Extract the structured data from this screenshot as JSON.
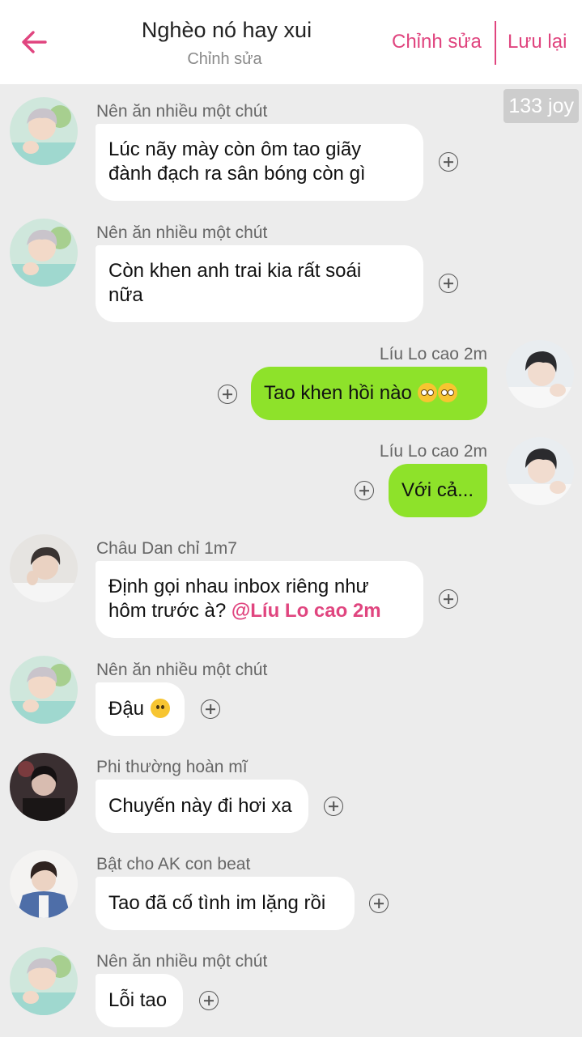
{
  "header": {
    "title": "Nghèo nó hay xui",
    "subtitle": "Chỉnh sửa",
    "edit_label": "Chỉnh sửa",
    "save_label": "Lưu lại",
    "accent_color": "#e0457f"
  },
  "watermark": "133 joy",
  "messages": [
    {
      "sender": "Nên ăn nhiều một chút",
      "lines": [
        "Lúc nãy mày còn ôm tao giãy",
        "đành đạch ra sân bóng còn gì"
      ],
      "direction": "incoming",
      "avatar": "avatar-1"
    },
    {
      "sender": "Nên ăn nhiều một chút",
      "lines": [
        "Còn khen anh trai kia rất soái",
        "nữa"
      ],
      "direction": "incoming",
      "avatar": "avatar-1"
    },
    {
      "sender": "Líu Lo cao 2m",
      "text": "Tao khen hồi nào",
      "emoji": "eye-roll-emoji x2",
      "direction": "outgoing",
      "avatar": "avatar-2"
    },
    {
      "sender": "Líu Lo cao 2m",
      "text": "Với cả...",
      "direction": "outgoing",
      "avatar": "avatar-2"
    },
    {
      "sender": "Châu Dan chỉ 1m7",
      "line1": "Định gọi nhau inbox riêng như",
      "line2": "hôm trước à?",
      "mention": "@Líu Lo cao 2m",
      "direction": "incoming",
      "avatar": "avatar-3"
    },
    {
      "sender": "Nên ăn nhiều một chút",
      "text": "Đậu",
      "emoji": "blank-face-emoji",
      "direction": "incoming",
      "avatar": "avatar-1"
    },
    {
      "sender": "Phi thường hoàn mĩ",
      "text": "Chuyến này đi hơi xa",
      "direction": "incoming",
      "avatar": "avatar-4"
    },
    {
      "sender": "Bật cho AK con beat",
      "text": "Tao đã cố tình im lặng rồi",
      "direction": "incoming",
      "avatar": "avatar-5"
    },
    {
      "sender": "Nên ăn nhiều một chút",
      "text": "Lỗi tao",
      "direction": "incoming",
      "avatar": "avatar-1"
    }
  ]
}
